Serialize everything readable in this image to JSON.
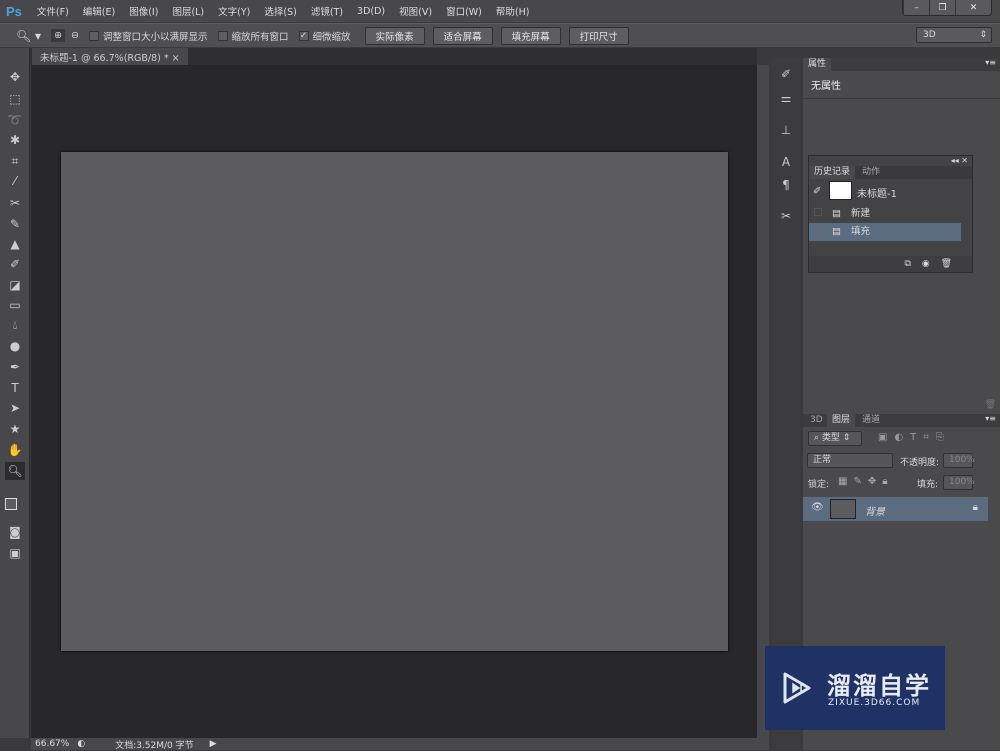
{
  "app": {
    "logo": "Ps"
  },
  "menu": [
    "文件(F)",
    "编辑(E)",
    "图像(I)",
    "图层(L)",
    "文字(Y)",
    "选择(S)",
    "滤镜(T)",
    "3D(D)",
    "视图(V)",
    "窗口(W)",
    "帮助(H)"
  ],
  "window_buttons": {
    "minimize": "–",
    "restore": "❐",
    "close": "✕"
  },
  "options": {
    "checkbox_resize": "调整窗口大小以满屏显示",
    "checkbox_resize_checked": false,
    "checkbox_all": "缩放所有窗口",
    "checkbox_all_checked": false,
    "checkbox_scrubby": "细微缩放",
    "checkbox_scrubby_checked": true,
    "btn_actual": "实际像素",
    "btn_fit": "适合屏幕",
    "btn_fill": "填充屏幕",
    "btn_print": "打印尺寸",
    "workspace": "3D"
  },
  "document": {
    "tab": "未标题-1 @ 66.7%(RGB/8) *",
    "canvas_color": "#5c5b5f"
  },
  "status": {
    "zoom": "66.67%",
    "doc": "文档:3.52M/0 字节"
  },
  "properties": {
    "tab": "属性",
    "content": "无属性"
  },
  "history": {
    "tabs": [
      "历史记录",
      "动作"
    ],
    "snapshot": "未标题-1",
    "items": [
      {
        "label": "新建",
        "selected": false
      },
      {
        "label": "填充",
        "selected": true
      }
    ]
  },
  "layers": {
    "tabs": [
      "3D",
      "图层",
      "通道"
    ],
    "filter": "类型",
    "blend": "正常",
    "opacity_label": "不透明度:",
    "opacity": "100%",
    "lock_label": "锁定:",
    "fill_label": "填充:",
    "fill": "100%",
    "items": [
      {
        "name": "背景",
        "visible": true,
        "locked": true
      }
    ]
  },
  "watermark": {
    "title": "溜溜自学",
    "url": "ZIXUE.3D66.COM",
    "bg": "#1f3265"
  }
}
